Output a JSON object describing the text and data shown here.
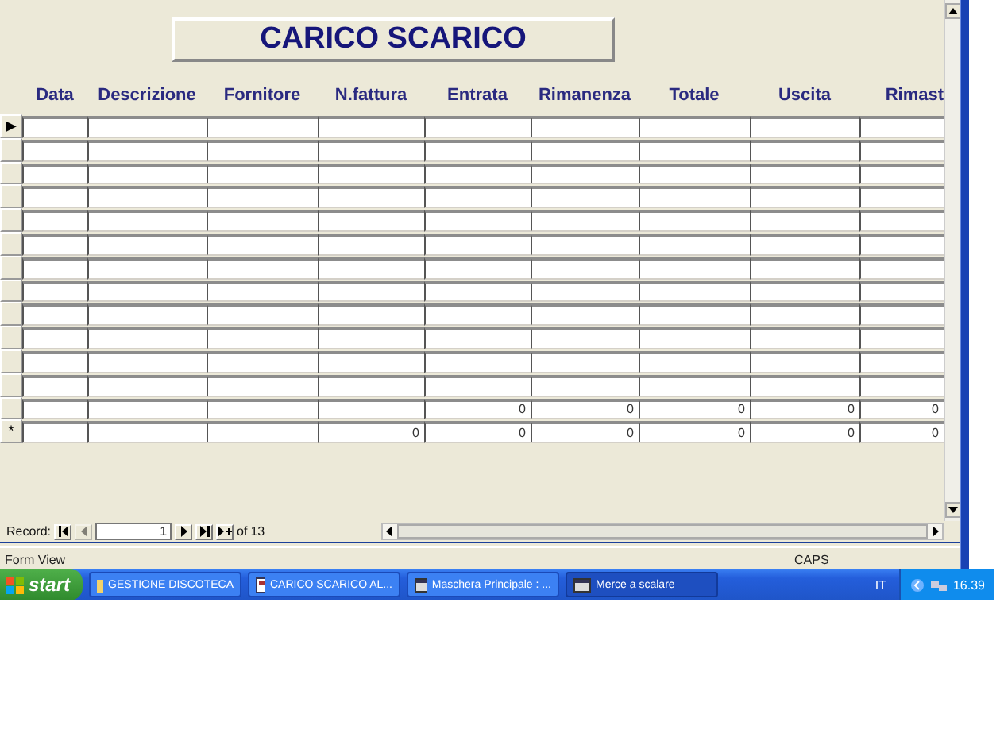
{
  "form": {
    "title": "CARICO SCARICO",
    "columns": [
      "Data",
      "Descrizione",
      "Fornitore",
      "N.fattura",
      "Entrata",
      "Rimanenza",
      "Totale",
      "Uscita",
      "Rimast"
    ],
    "rows": [
      {
        "selector": "▶",
        "cells": [
          null,
          null,
          null,
          null,
          null,
          null,
          null,
          null,
          null
        ]
      },
      {
        "cells": [
          null,
          null,
          null,
          null,
          null,
          null,
          null,
          null,
          null
        ]
      },
      {
        "cells": [
          null,
          null,
          null,
          null,
          null,
          null,
          null,
          null,
          null
        ]
      },
      {
        "cells": [
          null,
          null,
          null,
          null,
          null,
          null,
          null,
          null,
          null
        ]
      },
      {
        "cells": [
          null,
          null,
          null,
          null,
          null,
          null,
          null,
          null,
          null
        ]
      },
      {
        "cells": [
          null,
          null,
          null,
          null,
          null,
          null,
          null,
          null,
          null
        ]
      },
      {
        "cells": [
          null,
          null,
          null,
          null,
          null,
          null,
          null,
          null,
          null
        ]
      },
      {
        "cells": [
          null,
          null,
          null,
          null,
          null,
          null,
          null,
          null,
          null
        ]
      },
      {
        "cells": [
          null,
          null,
          null,
          null,
          null,
          null,
          null,
          null,
          null
        ]
      },
      {
        "cells": [
          null,
          null,
          null,
          null,
          null,
          null,
          null,
          null,
          null
        ]
      },
      {
        "cells": [
          null,
          null,
          null,
          null,
          null,
          null,
          null,
          null,
          null
        ]
      },
      {
        "cells": [
          null,
          null,
          null,
          null,
          null,
          null,
          null,
          null,
          null
        ]
      },
      {
        "cells": [
          null,
          null,
          null,
          null,
          "0",
          "0",
          "0",
          "0",
          "0"
        ]
      },
      {
        "selector": "*",
        "cells": [
          null,
          null,
          null,
          "0",
          "0",
          "0",
          "0",
          "0",
          "0"
        ]
      }
    ]
  },
  "record_navigation": {
    "label": "Record:",
    "current": "1",
    "of_label": "of",
    "total": "13",
    "previous_disabled": true
  },
  "status_bar": {
    "mode": "Form View",
    "caps": "CAPS"
  },
  "taskbar": {
    "start": "start",
    "items": [
      {
        "label": "GESTIONE DISCOTECA",
        "kind": "folder",
        "selected": false
      },
      {
        "label": "CARICO SCARICO AL...",
        "kind": "form",
        "selected": false
      },
      {
        "label": "Maschera Principale : ...",
        "kind": "window",
        "selected": false
      },
      {
        "label": "Merce a scalare",
        "kind": "window",
        "selected": true
      }
    ],
    "language": "IT",
    "clock": "16.39"
  }
}
